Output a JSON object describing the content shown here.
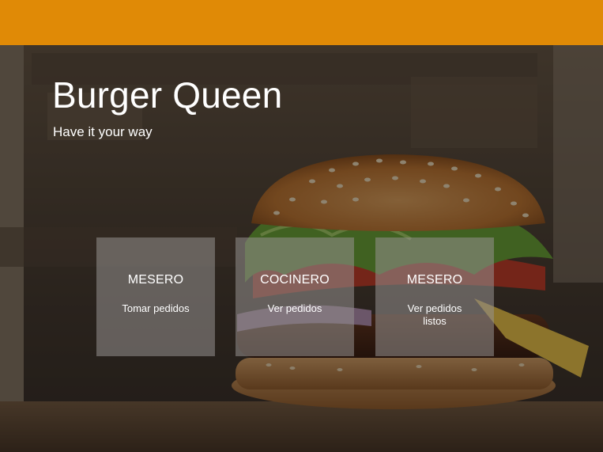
{
  "header": {
    "bar_color": "#e08a06"
  },
  "hero": {
    "title": "Burger Queen",
    "subtitle": "Have it your way",
    "background_image": "burger-photo"
  },
  "cards": [
    {
      "role": "MESERO",
      "action": "Tomar pedidos"
    },
    {
      "role": "COCINERO",
      "action": "Ver pedidos"
    },
    {
      "role": "MESERO",
      "action": "Ver pedidos listos"
    }
  ]
}
